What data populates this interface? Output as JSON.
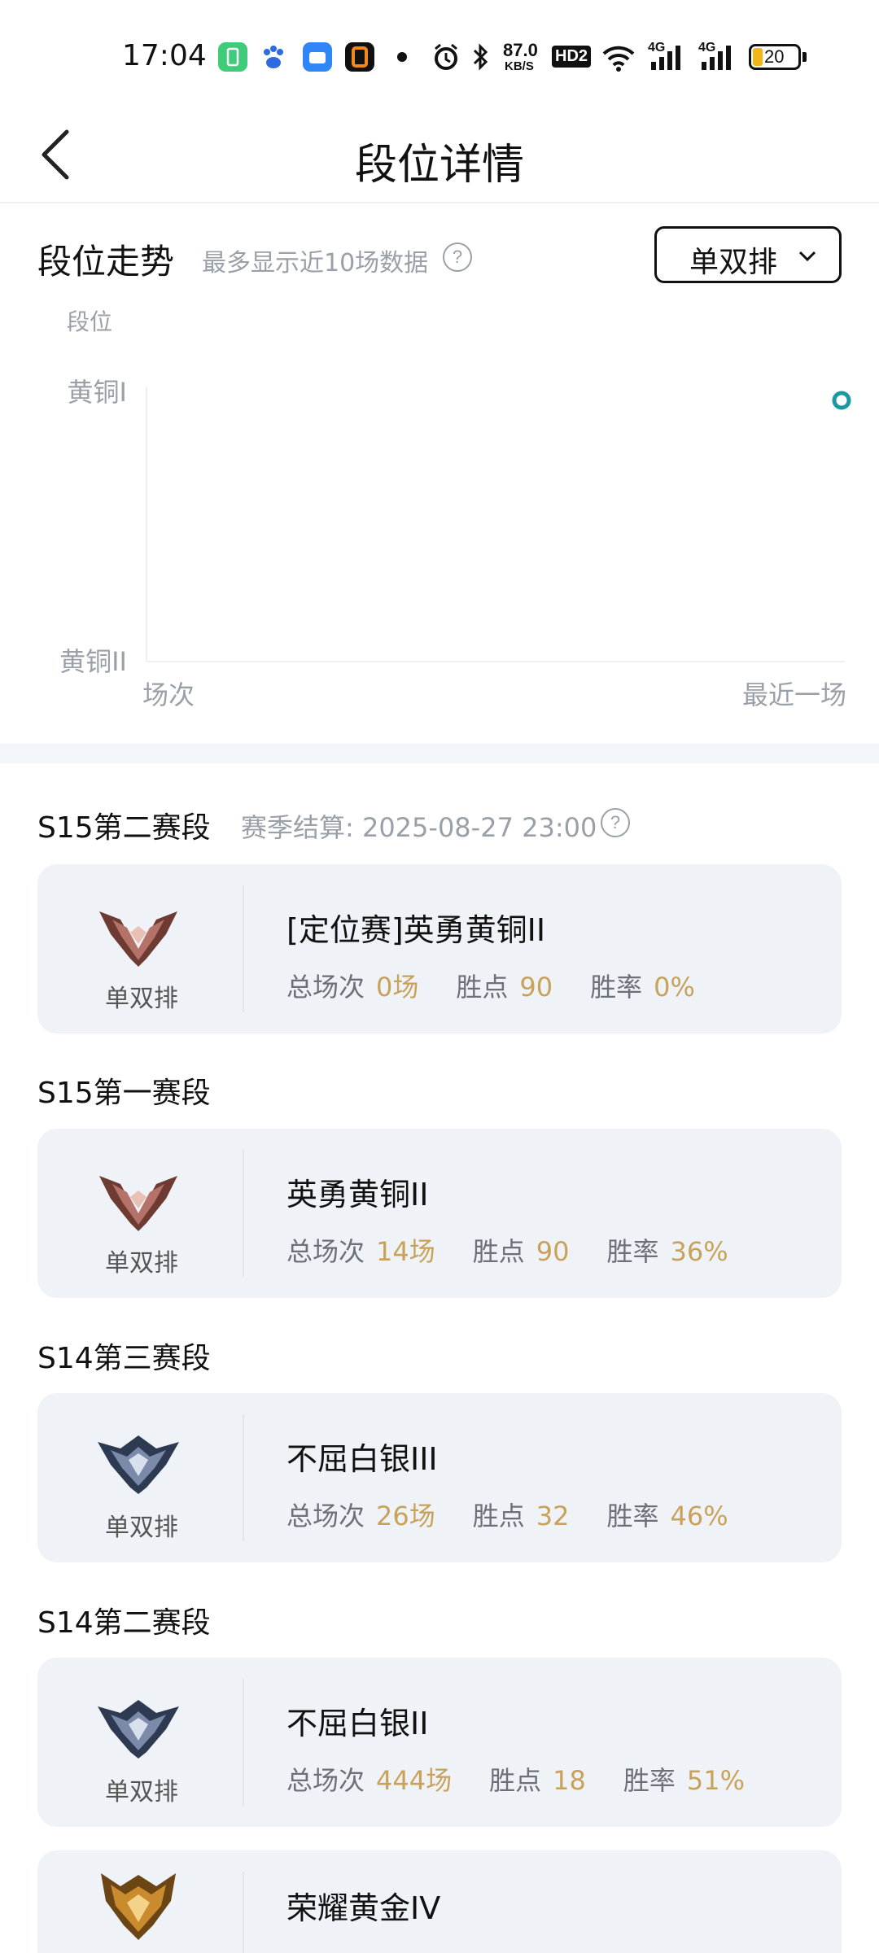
{
  "status_bar": {
    "time": "17:04",
    "net_speed": "87.0",
    "net_unit": "KB/S",
    "hd": "HD2",
    "net1": "4G",
    "net2": "4G",
    "battery": "20",
    "icons": [
      "battery-app-icon",
      "baidu-icon",
      "app-blue-icon",
      "app-orange-icon",
      "dot-icon",
      "alarm-icon",
      "bluetooth-icon",
      "hd-icon",
      "wifi-icon",
      "signal-icon",
      "signal-icon",
      "battery-icon"
    ]
  },
  "header": {
    "title": "段位详情",
    "back_icon": "back-arrow-icon"
  },
  "trend": {
    "title": "段位走势",
    "hint": "最多显示近10场数据",
    "help": "?",
    "mode": "单双排"
  },
  "chart_data": {
    "type": "line",
    "ylabel": "段位",
    "y_categories": [
      "黄铜II",
      "黄铜I"
    ],
    "xlabel_left": "场次",
    "xlabel_right": "最近一场",
    "series": [
      {
        "values": [
          {
            "x": "最近一场",
            "y": "黄铜I"
          }
        ]
      }
    ],
    "colors": {
      "point": "#1a9aa0"
    }
  },
  "seasons": [
    {
      "title": "S15第二赛段",
      "settle": "赛季结算: 2025-08-27 23:00",
      "help": "?",
      "mode": "单双排",
      "rank": "[定位赛]英勇黄铜II",
      "icon": "bronze-rank-icon",
      "games_label": "总场次",
      "games": "0场",
      "points_label": "胜点",
      "points": "90",
      "winrate_label": "胜率",
      "winrate": "0%"
    },
    {
      "title": "S15第一赛段",
      "mode": "单双排",
      "rank": "英勇黄铜II",
      "icon": "bronze-rank-icon",
      "games_label": "总场次",
      "games": "14场",
      "points_label": "胜点",
      "points": "90",
      "winrate_label": "胜率",
      "winrate": "36%"
    },
    {
      "title": "S14第三赛段",
      "mode": "单双排",
      "rank": "不屈白银III",
      "icon": "silver-rank-icon",
      "games_label": "总场次",
      "games": "26场",
      "points_label": "胜点",
      "points": "32",
      "winrate_label": "胜率",
      "winrate": "46%"
    },
    {
      "title": "S14第二赛段",
      "mode": "单双排",
      "rank": "不屈白银II",
      "icon": "silver-rank-icon",
      "games_label": "总场次",
      "games": "444场",
      "points_label": "胜点",
      "points": "18",
      "winrate_label": "胜率",
      "winrate": "51%"
    },
    {
      "rank": "荣耀黄金IV",
      "icon": "gold-rank-icon"
    }
  ],
  "colors": {
    "accent_value": "#c9a25a",
    "card_bg": "#eff2f7",
    "muted": "#9aa0a8"
  }
}
